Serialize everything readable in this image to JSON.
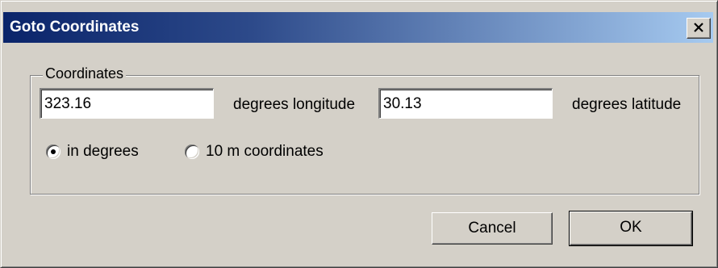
{
  "window": {
    "title": "Goto Coordinates"
  },
  "group": {
    "label": "Coordinates"
  },
  "longitude": {
    "value": "323.16",
    "unit_label": "degrees longitude"
  },
  "latitude": {
    "value": "30.13",
    "unit_label": "degrees latitude"
  },
  "mode": {
    "options": [
      {
        "label": "in degrees",
        "selected": true
      },
      {
        "label": "10 m coordinates",
        "selected": false
      }
    ]
  },
  "buttons": {
    "cancel_label": "Cancel",
    "ok_label": "OK"
  },
  "colors": {
    "face": "#d4d0c8",
    "title_start": "#0a246a",
    "title_end": "#a6caf0"
  },
  "icons": {
    "close": "close-icon"
  }
}
